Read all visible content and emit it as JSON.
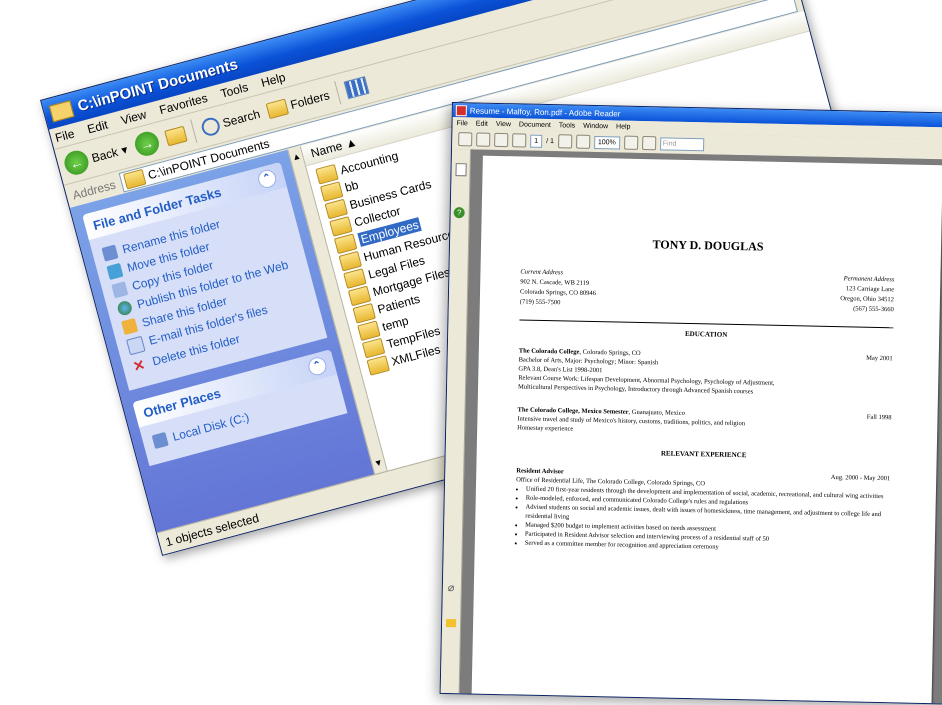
{
  "explorer": {
    "title": "C:\\inPOINT Documents",
    "menu": [
      "File",
      "Edit",
      "View",
      "Favorites",
      "Tools",
      "Help"
    ],
    "toolbar": {
      "back": "Back",
      "search": "Search",
      "folders": "Folders"
    },
    "address_label": "Address",
    "address_value": "C:\\inPOINT Documents",
    "tasks_panel": {
      "title": "File and Folder Tasks",
      "items": [
        {
          "label": "Rename this folder",
          "icon": "rename-icon"
        },
        {
          "label": "Move this folder",
          "icon": "move-icon"
        },
        {
          "label": "Copy this folder",
          "icon": "copy-icon"
        },
        {
          "label": "Publish this folder to the Web",
          "icon": "globe-icon"
        },
        {
          "label": "Share this folder",
          "icon": "share-icon"
        },
        {
          "label": "E-mail this folder's files",
          "icon": "email-icon"
        },
        {
          "label": "Delete this folder",
          "icon": "delete-icon"
        }
      ]
    },
    "other_places": {
      "title": "Other Places",
      "items": [
        "Local Disk (C:)"
      ]
    },
    "column_name": "Name",
    "folders": [
      "Accounting",
      "bb",
      "Business Cards",
      "Collector",
      "Employees",
      "Human Resources",
      "Legal Files",
      "Mortgage Files",
      "Patients",
      "temp",
      "TempFiles",
      "XMLFiles"
    ],
    "selected_folder": "Employees",
    "status": "1 objects selected"
  },
  "reader": {
    "title": "Resume - Malfoy, Ron.pdf - Adobe Reader",
    "menu": [
      "File",
      "Edit",
      "View",
      "Document",
      "Tools",
      "Window",
      "Help"
    ],
    "page_current": "1",
    "page_total": "/ 1",
    "zoom": "100%",
    "find_placeholder": "Find",
    "resume": {
      "name": "TONY D. DOUGLAS",
      "current_label": "Current Address",
      "current": [
        "902 N. Cascade, WB 2119",
        "Colorado Springs, CO 80946",
        "(719) 555-7500"
      ],
      "permanent_label": "Permanent Address",
      "permanent": [
        "123 Carriage Lane",
        "Oregon, Ohio 34512",
        "(567) 555-3660"
      ],
      "education_heading": "EDUCATION",
      "edu1": {
        "school": "The Colorado College",
        "location": ", Colorado Springs, CO",
        "date": "May 2001",
        "lines": [
          "Bachelor of Arts, Major: Psychology; Minor: Spanish",
          "GPA 3.8, Dean's List 1998-2001",
          "Relevant Course Work: Lifespan Development, Abnormal Psychology, Psychology of Adjustment,",
          "Multicultural Perspectives in Psychology, Introductory through Advanced Spanish courses"
        ]
      },
      "edu2": {
        "school": "The Colorado College, Mexico Semester",
        "location": ", Guanajuato, Mexico",
        "date": "Fall 1998",
        "lines": [
          "Intensive travel and study of Mexico's history, customs, traditions, politics, and religion",
          "Homestay experience"
        ]
      },
      "experience_heading": "RELEVANT EXPERIENCE",
      "exp1": {
        "title": "Resident Advisor",
        "date": "Aug. 2000 - May 2001",
        "org": "Office of Residential Life, The Colorado College, Colorado Springs, CO",
        "bullets": [
          "Unified 20 first-year residents through the development and implementation of social, academic, recreational, and cultural wing activities",
          "Role-modeled, enforced, and communicated Colorado College's rules and regulations",
          "Advised students on social and academic issues, dealt with issues of homesickness, time management, and adjustment to college life and residential living",
          "Managed $200 budget to implement activities based on needs assessment",
          "Participated in Resident Advisor selection and interviewing process of a residential staff of 50",
          "Served as a committee member for recognition and appreciation ceremony"
        ]
      }
    }
  }
}
